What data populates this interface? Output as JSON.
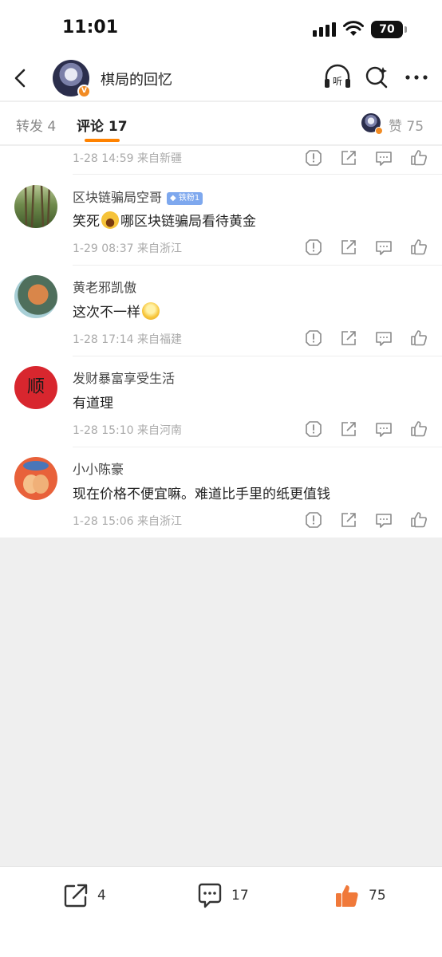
{
  "status": {
    "time": "11:01",
    "battery": "70"
  },
  "nav": {
    "title": "棋局的回忆",
    "listen_label": "听"
  },
  "tabs": {
    "repost": "转发 4",
    "comments": "评论 17",
    "likes": "赞 75"
  },
  "colors": {
    "accent": "#ff8200",
    "fan_badge": "#7ea8ee",
    "meta_text": "#aaaaaa"
  },
  "comments": [
    {
      "meta": "1-28 14:59  来自新疆"
    },
    {
      "user": "区块链骗局空哥",
      "badge": "铁粉1",
      "text_a": "笑死",
      "text_b": "哪区块链骗局看待黄金",
      "meta": "1-29 08:37  来自浙江"
    },
    {
      "user": "黄老邪凯傲",
      "text_a": "这次不一样",
      "meta": "1-28 17:14  来自福建"
    },
    {
      "user": "发财暴富享受生活",
      "text_a": "有道理",
      "meta": "1-28 15:10  来自河南",
      "avatar_glyph": "顺"
    },
    {
      "user": "小小陈豪",
      "text_a": "现在价格不便宜嘛。难道比手里的纸更值钱",
      "meta": "1-28 15:06  来自浙江"
    }
  ],
  "bottom_bar": {
    "repost_count": "4",
    "comment_count": "17",
    "like_count": "75"
  }
}
